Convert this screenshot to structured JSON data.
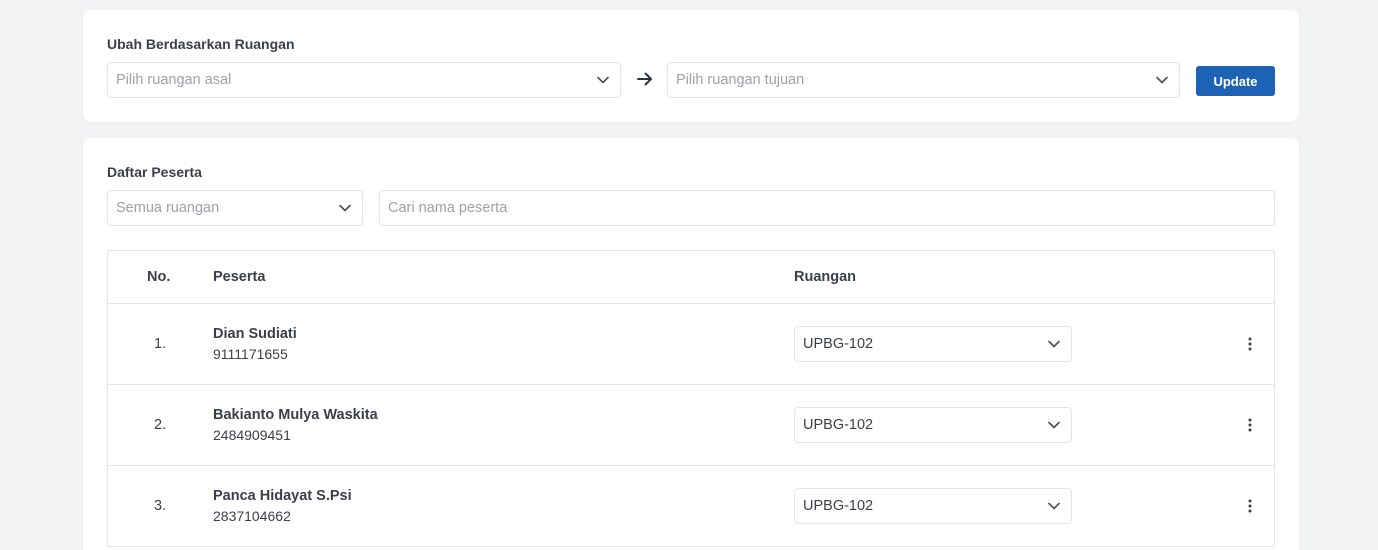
{
  "room_update": {
    "title": "Ubah Berdasarkan Ruangan",
    "source_placeholder": "Pilih ruangan asal",
    "target_placeholder": "Pilih ruangan tujuan",
    "update_label": "Update",
    "arrow_icon": "arrow-right-icon"
  },
  "participants": {
    "title": "Daftar Peserta",
    "room_filter": "Semua ruangan",
    "search_placeholder": "Cari nama peserta",
    "columns": {
      "no": "No.",
      "participant": "Peserta",
      "room": "Ruangan"
    },
    "rows": [
      {
        "no": "1.",
        "name": "Dian Sudiati",
        "id": "9111171655",
        "room": "UPBG-102"
      },
      {
        "no": "2.",
        "name": "Bakianto Mulya Waskita",
        "id": "2484909451",
        "room": "UPBG-102"
      },
      {
        "no": "3.",
        "name": "Panca Hidayat S.Psi",
        "id": "2837104662",
        "room": "UPBG-102"
      }
    ]
  },
  "colors": {
    "background": "#f2f3f5",
    "card": "#ffffff",
    "accent": "#1c63b5",
    "border": "#e3e5ea",
    "text": "#3a3f4b",
    "placeholder": "#9ca1ab"
  }
}
